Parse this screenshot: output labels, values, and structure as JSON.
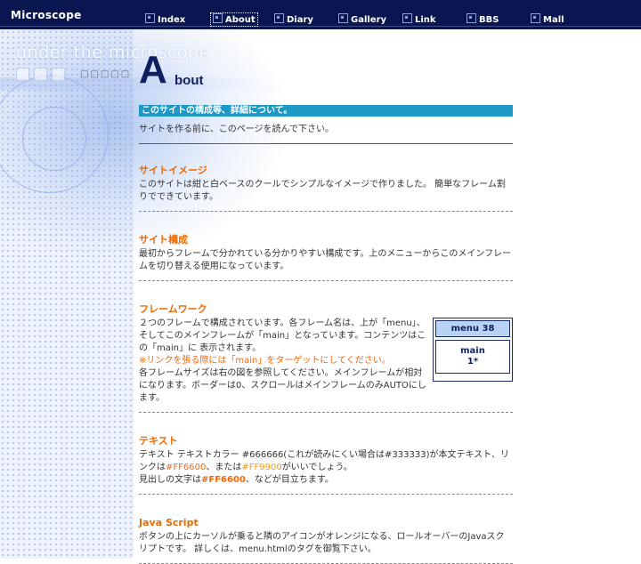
{
  "site_title": "Microscope",
  "menu": [
    {
      "label": "Index"
    },
    {
      "label": "About"
    },
    {
      "label": "Diary"
    },
    {
      "label": "Gallery"
    },
    {
      "label": "Link"
    },
    {
      "label": "BBS"
    },
    {
      "label": "Mall"
    }
  ],
  "deco": {
    "ghost_text": "under the microscope",
    "dots": "□□□□□"
  },
  "heading": {
    "big": "A",
    "rest": "bout"
  },
  "banner": "このサイトの構成等、詳細について。",
  "intro": "サイトを作る前に、このページを読んで下さい。",
  "sections": {
    "image": {
      "title": "サイトイメージ",
      "body": "このサイトは紺と白ベースのクールでシンプルなイメージで作りました。 簡単なフレーム割りでできています。"
    },
    "structure": {
      "title": "サイト構成",
      "body": "最初からフレームで分かれている分かりやすい構成です。上のメニューからこのメインフレームを切り替える使用になっています。"
    },
    "frame": {
      "title": "フレームワーク",
      "line1": "２つのフレームで構成されています。各フレーム名は、上が「menu」、そしてこのメインフレームが「main」となっています。コンテンツはこの「main」に 表示されます。",
      "warn": "※リンクを張る際には「main」をターゲットにしてください。",
      "line2": "各フレームサイズは右の図を参照してください。メインフレームが相対になります。ボーダーは0、スクロールはメインフレームのみAUTOにします。",
      "diagram_top": "menu 38",
      "diagram_main1": "main",
      "diagram_main2": "1*"
    },
    "text": {
      "title": "テキスト",
      "p1": "テキスト テキストカラー #666666(これが読みにくい場合は#333333)が本文テキスト、リンクは",
      "c1": "#FF6600",
      "p2": "、または",
      "c2": "#FF9900",
      "p3": "がいいでしょう。",
      "p4": "見出しの文字は",
      "c3": "#FF6600",
      "p5": "、などが目立ちます。"
    },
    "js": {
      "title": "Java Script",
      "body": "ボタンの上にカーソルが乗ると隣のアイコンがオレンジになる、ロールオーバーのJavaスクリプトです。 詳しくは、menu.htmlのタグを御覧下さい。"
    }
  }
}
